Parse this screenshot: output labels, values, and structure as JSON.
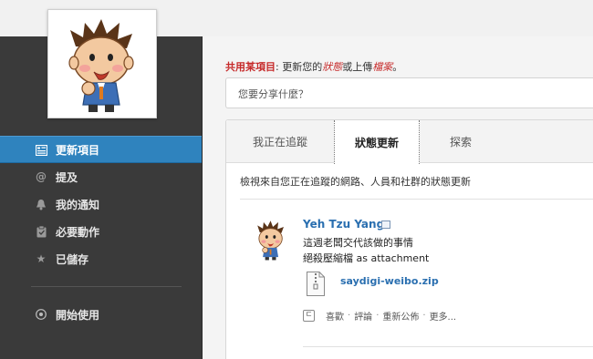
{
  "profile": {
    "avatar_icon": "cartoon-boy-avatar"
  },
  "nav": {
    "items": [
      {
        "label": "更新項目",
        "icon": "news-feed-icon",
        "active": true
      },
      {
        "label": "提及",
        "icon": "at-icon"
      },
      {
        "label": "我的通知",
        "icon": "bell-icon"
      },
      {
        "label": "必要動作",
        "icon": "clipboard-icon"
      },
      {
        "label": "已儲存",
        "icon": "star-icon"
      }
    ],
    "getting_started": {
      "label": "開始使用",
      "icon": "play-icon"
    }
  },
  "share": {
    "prefix": "共用某項目",
    "colon": ": ",
    "text1": "更新您的",
    "status_word": "狀態",
    "text2": "或上傳",
    "file_word": "檔案",
    "suffix": "。",
    "placeholder": "您要分享什麼？"
  },
  "tabs": [
    {
      "label": "我正在追蹤"
    },
    {
      "label": "狀態更新",
      "active": true
    },
    {
      "label": "探索"
    }
  ],
  "feed": {
    "description": "檢視來自您正在追蹤的網路、人員和社群的狀態更新"
  },
  "post": {
    "author": "Yeh Tzu Yang",
    "line1": "這週老闆交代該做的事情",
    "line2": "絕殺壓縮檔 as attachment",
    "attachment": "saydigi-weibo.zip",
    "actions": [
      "喜歡",
      "評論",
      "重新公佈",
      "更多..."
    ]
  }
}
